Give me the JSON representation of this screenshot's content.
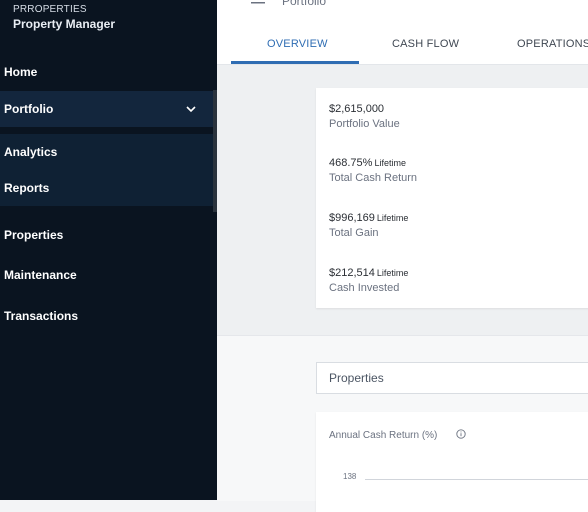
{
  "sidebar": {
    "brand_small": "PRROPERTIES",
    "brand_title": "Property Manager",
    "items": [
      {
        "label": "Home"
      },
      {
        "label": "Portfolio"
      },
      {
        "label": "Analytics"
      },
      {
        "label": "Reports"
      },
      {
        "label": "Properties"
      },
      {
        "label": "Maintenance"
      },
      {
        "label": "Transactions"
      }
    ]
  },
  "header": {
    "breadcrumb": "Portfolio",
    "tabs": [
      {
        "label": "OVERVIEW",
        "active": true
      },
      {
        "label": "CASH FLOW"
      },
      {
        "label": "OPERATIONS"
      }
    ]
  },
  "summary": {
    "metrics": [
      {
        "value": "$2,615,000",
        "qualifier": "",
        "label": "Portfolio Value"
      },
      {
        "value": "468.75%",
        "qualifier": "Lifetime",
        "label": "Total Cash Return"
      },
      {
        "value": "$996,169",
        "qualifier": "Lifetime",
        "label": "Total Gain"
      },
      {
        "value": "$212,514",
        "qualifier": "Lifetime",
        "label": "Cash Invested"
      }
    ]
  },
  "properties_select": {
    "value": "Properties"
  },
  "chart": {
    "title": "Annual Cash Return (%)",
    "tick_top": "138"
  },
  "colors": {
    "accent": "#2f6db3",
    "sidebar": "#0a1420"
  }
}
